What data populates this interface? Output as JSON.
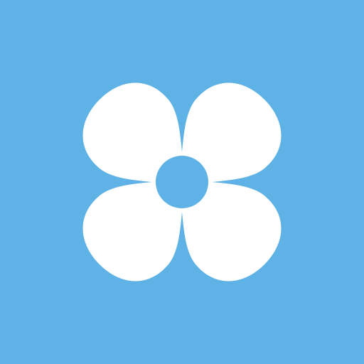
{
  "icon": {
    "name": "four-petal-flower-icon",
    "background_color": "#5fb2e5",
    "petal_color": "#ffffff",
    "center_color": "#5fb2e5",
    "petal_count": 4
  }
}
